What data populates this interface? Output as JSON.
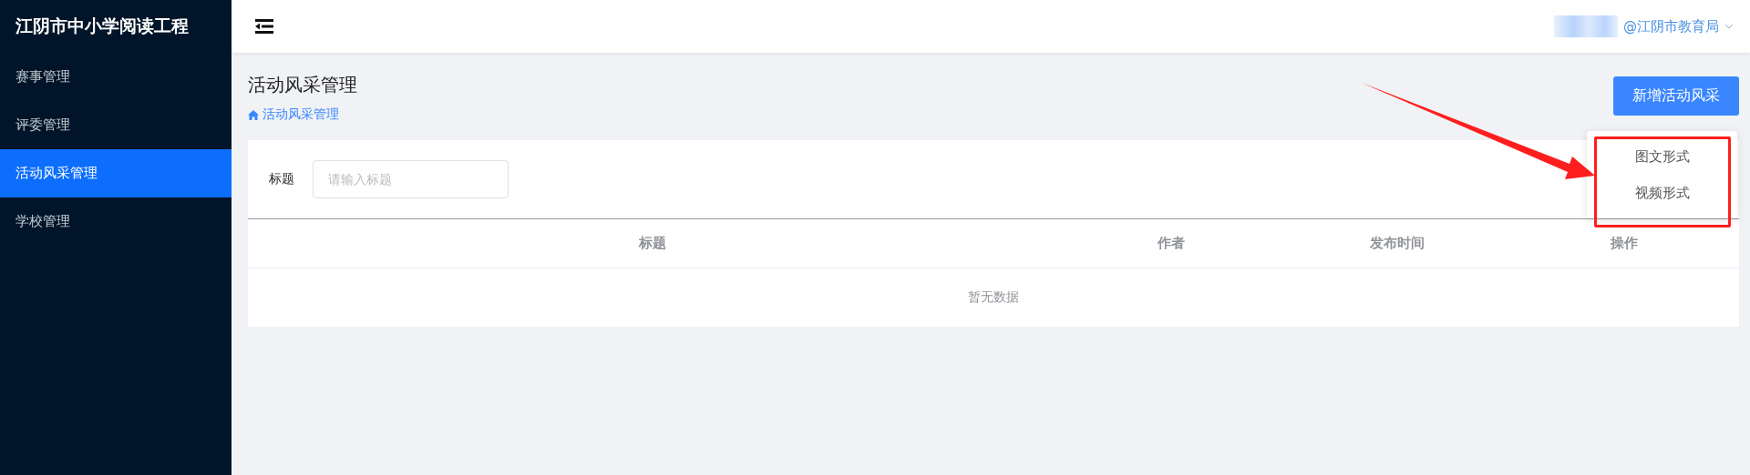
{
  "sidebar": {
    "logo": "江阴市中小学阅读工程",
    "items": [
      {
        "label": "赛事管理",
        "selected": false
      },
      {
        "label": "评委管理",
        "selected": false
      },
      {
        "label": "活动风采管理",
        "selected": true
      },
      {
        "label": "学校管理",
        "selected": false
      }
    ]
  },
  "header": {
    "user": "@江阴市教育局"
  },
  "page": {
    "title": "活动风采管理",
    "breadcrumb": "活动风采管理",
    "add_button": "新增活动风采",
    "dropdown": [
      "图文形式",
      "视频形式"
    ]
  },
  "filter": {
    "label": "标题",
    "placeholder": "请输入标题"
  },
  "table": {
    "columns": [
      "标题",
      "作者",
      "发布时间",
      "操作"
    ],
    "empty_text": "暂无数据"
  }
}
